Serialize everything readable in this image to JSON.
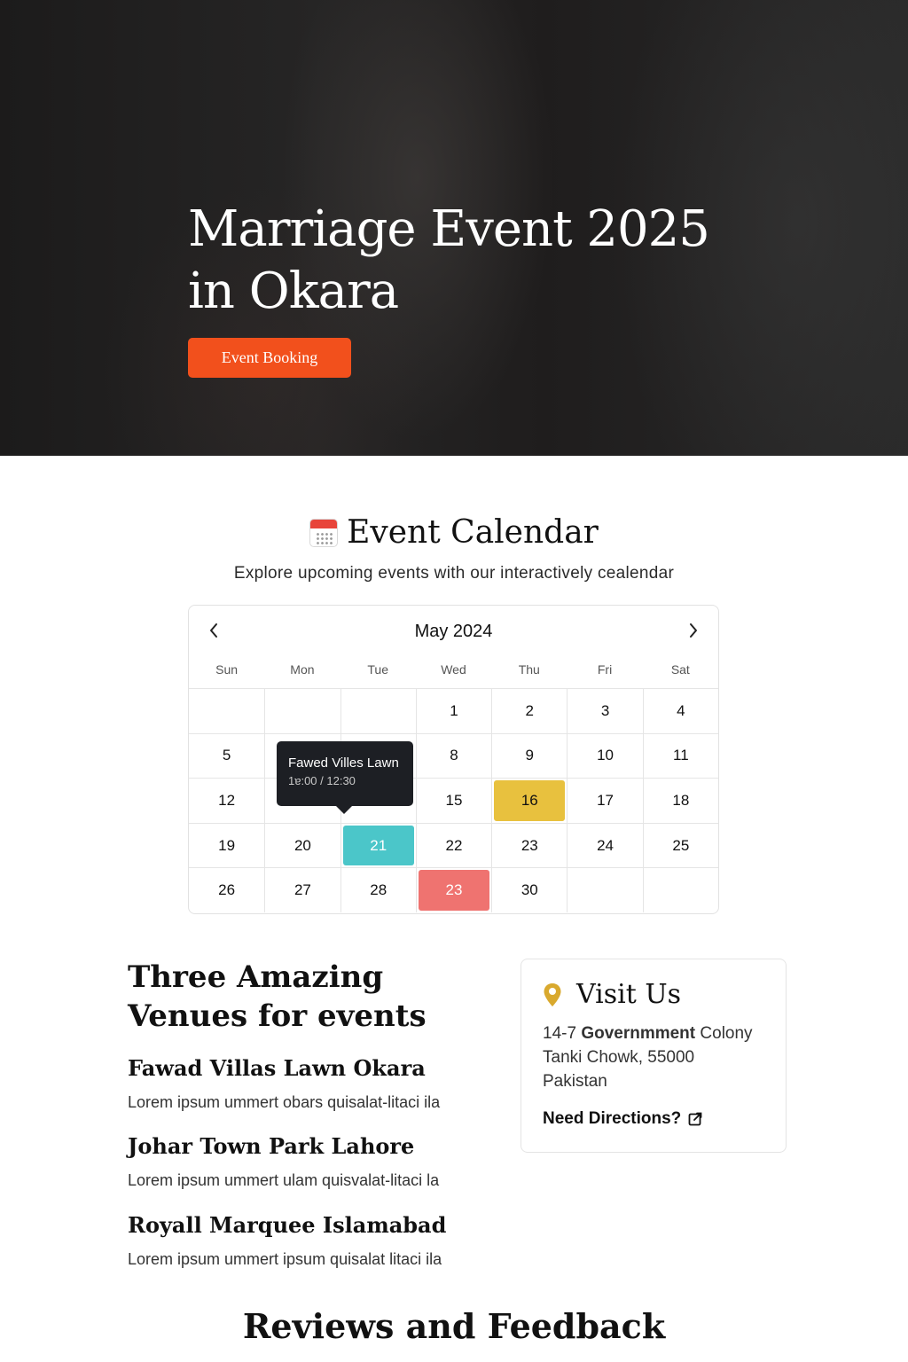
{
  "hero": {
    "title": "Marriage Event 2025 in Okara",
    "button_label": "Event Booking",
    "accent": "#f2501c"
  },
  "calendar_section": {
    "icon": "calendar-icon",
    "heading": "Event Calendar",
    "subtitle": "Explore upcoming events with our interactively cealendar"
  },
  "calendar": {
    "month_label": "May 2024",
    "prev_icon": "chevron-left-icon",
    "next_icon": "chevron-right-icon",
    "weekdays": [
      "Sun",
      "Mon",
      "Tue",
      "Wed",
      "Thu",
      "Fri",
      "Sat"
    ],
    "weeks": [
      [
        "",
        "",
        "",
        "1",
        "2",
        "3",
        "4"
      ],
      [
        "5",
        "",
        "",
        "8",
        "9",
        "10",
        "11"
      ],
      [
        "12",
        "",
        "",
        "15",
        "16",
        "17",
        "18"
      ],
      [
        "19",
        "20",
        "21",
        "22",
        "23",
        "24",
        "25"
      ],
      [
        "26",
        "27",
        "28",
        "23",
        "30",
        "",
        ""
      ]
    ],
    "highlights": [
      {
        "week": 2,
        "day": 4,
        "color": "#e8c13e",
        "text_color": "#111111"
      },
      {
        "week": 3,
        "day": 2,
        "color": "#4bc6c9",
        "text_color": "#ffffff"
      },
      {
        "week": 4,
        "day": 3,
        "color": "#ef7370",
        "text_color": "#ffffff"
      }
    ],
    "tooltip": {
      "title": "Fawed Villes Lawn",
      "time": "1ɐ:00 / 12:30"
    }
  },
  "venues": {
    "title": "Three Amazing Venues for events",
    "items": [
      {
        "name": "Fawad Villas Lawn Okara",
        "description": "Lorem ipsum ummert obars quisalat-litaci ila"
      },
      {
        "name": "Johar Town Park Lahore",
        "description": "Lorem ipsum ummert ulam quisvalat-litaci  la"
      },
      {
        "name": "Royall Marquee Islamabad",
        "description": "Lorem ipsum ummert ipsum quisalat litaci ila"
      }
    ]
  },
  "visit": {
    "icon": "map-pin-icon",
    "title": "Visit Us",
    "address_prefix": "14-7 ",
    "address_bold": "Governmment",
    "address_suffix": " Colony",
    "address_line2": "Tanki Chowk, 55000",
    "address_line3": "Pakistan",
    "directions_label": "Need Directions?",
    "directions_icon": "external-link-icon"
  },
  "reviews": {
    "title": "Reviews and Feedback"
  }
}
